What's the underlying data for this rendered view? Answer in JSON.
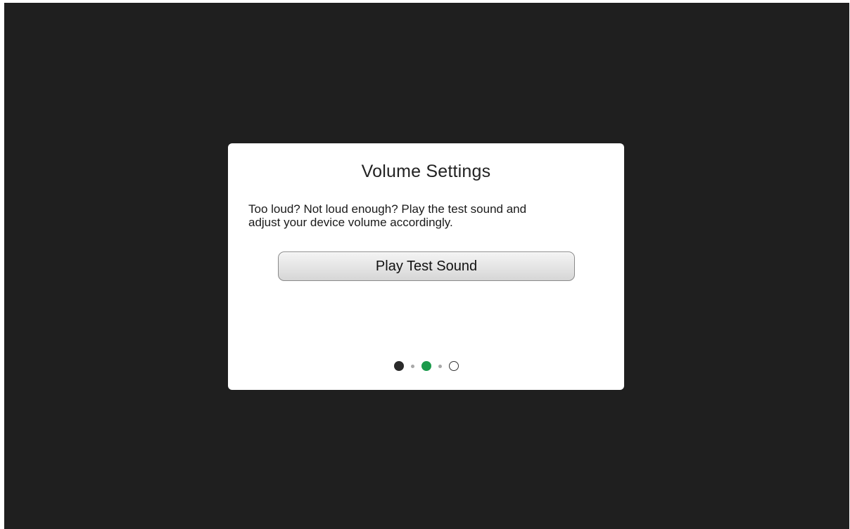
{
  "dialog": {
    "title": "Volume Settings",
    "message_line1": "Too loud? Not loud enough? Play the test sound and",
    "message_line2": "adjust your device volume accordingly.",
    "play_button_label": "Play Test Sound"
  },
  "pager": {
    "total_pages": 3,
    "current_page": 2,
    "colors": {
      "visited": "#2a2a2a",
      "current": "#1b9a4b",
      "upcoming": "#ffffff",
      "separator": "#a8a8a8"
    }
  },
  "colors": {
    "background": "#1f1f1f",
    "dialog": "#ffffff"
  }
}
